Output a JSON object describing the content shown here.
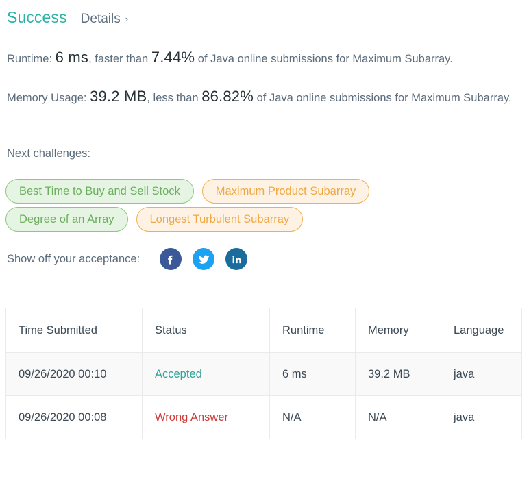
{
  "header": {
    "status_title": "Success",
    "details_label": "Details",
    "details_chevron": "›"
  },
  "stats": {
    "runtime": {
      "label_prefix": "Runtime: ",
      "value": "6 ms",
      "middle": ", faster than ",
      "percent": "7.44%",
      "suffix": " of Java online submissions for Maximum Subarray."
    },
    "memory": {
      "label_prefix": "Memory Usage: ",
      "value": "39.2 MB",
      "middle": ", less than ",
      "percent": "86.82%",
      "suffix": " of Java online submissions for Maximum Subarray."
    }
  },
  "next_challenges": {
    "label": "Next challenges:",
    "tags": [
      {
        "label": "Best Time to Buy and Sell Stock",
        "color": "green"
      },
      {
        "label": "Maximum Product Subarray",
        "color": "orange"
      },
      {
        "label": "Degree of an Array",
        "color": "green"
      },
      {
        "label": "Longest Turbulent Subarray",
        "color": "orange"
      }
    ]
  },
  "share": {
    "label": "Show off your acceptance:",
    "networks": [
      {
        "name": "facebook",
        "color": "#3B5998"
      },
      {
        "name": "twitter",
        "color": "#1DA1F2"
      },
      {
        "name": "linkedin",
        "color": "#1A6C9C"
      }
    ]
  },
  "submissions_table": {
    "columns": [
      "Time Submitted",
      "Status",
      "Runtime",
      "Memory",
      "Language"
    ],
    "rows": [
      {
        "time": "09/26/2020 00:10",
        "status": "Accepted",
        "status_type": "accepted",
        "runtime": "6 ms",
        "memory": "39.2 MB",
        "language": "java"
      },
      {
        "time": "09/26/2020 00:08",
        "status": "Wrong Answer",
        "status_type": "wrong",
        "runtime": "N/A",
        "memory": "N/A",
        "language": "java"
      }
    ]
  },
  "colors": {
    "success_teal": "#2DB3A6",
    "accepted_teal": "#2CA39B",
    "wrong_red": "#CC3B38",
    "tag_green_text": "#6CAF5F",
    "tag_green_bg": "#E6F4E3",
    "tag_orange_text": "#EFA845",
    "tag_orange_bg": "#FDF2E3",
    "body_text": "#5C6B7A"
  }
}
